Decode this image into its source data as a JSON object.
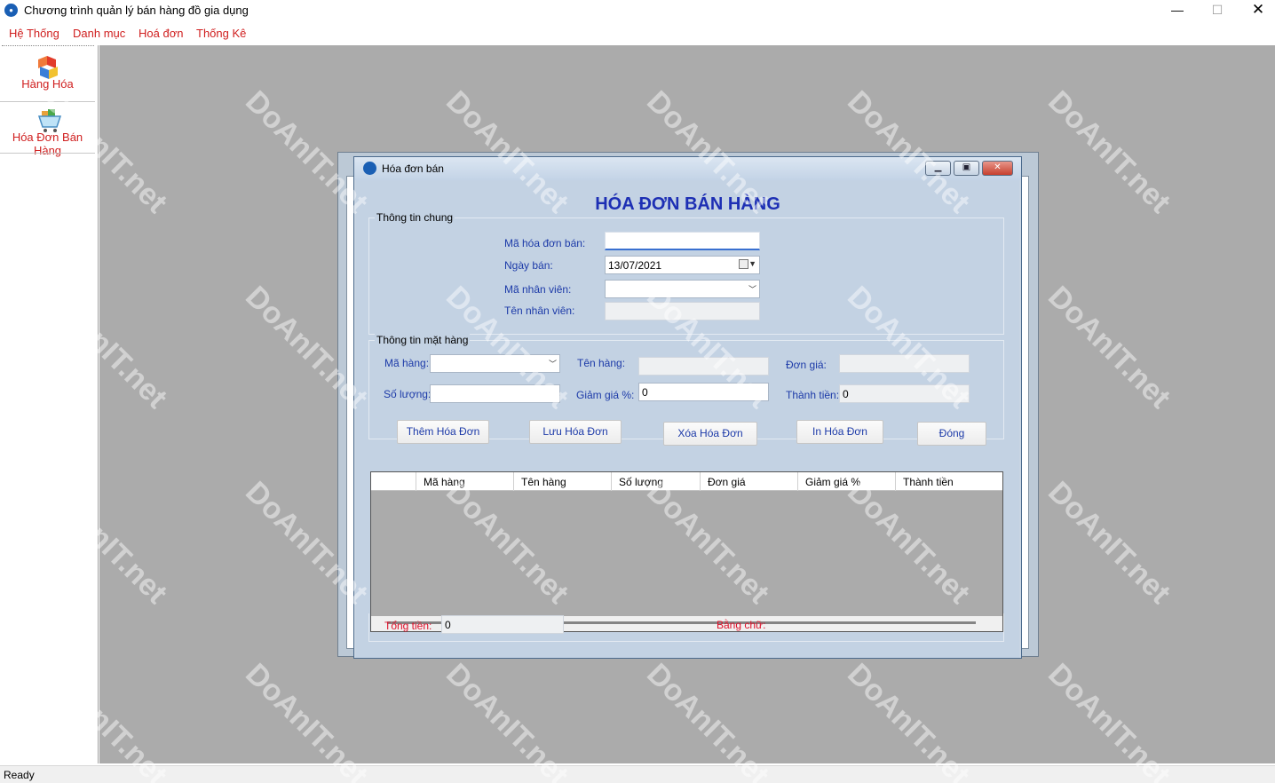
{
  "app": {
    "title": "Chương trình quản lý bán hàng đồ gia dụng",
    "window_controls": {
      "minimize": "—",
      "maximize": "☐",
      "close": "✕"
    }
  },
  "menu": [
    "Hệ Thống",
    "Danh mục",
    "Hoá đơn",
    "Thống Kê"
  ],
  "sidebar": [
    {
      "label": "Hàng Hóa",
      "icon": "boxes-icon"
    },
    {
      "label": "Hóa Đơn Bán Hàng",
      "icon": "shopping-cart-icon"
    }
  ],
  "status": "Ready",
  "invoice_window": {
    "title": "Hóa đơn bán",
    "heading": "HÓA ĐƠN BÁN HÀNG",
    "general_group": "Thông tin chung",
    "labels": {
      "invoice_id": "Mã hóa đơn bán:",
      "sale_date": "Ngày bán:",
      "employee_id": "Mã nhân viên:",
      "employee_name": "Tên nhân viên:"
    },
    "values": {
      "invoice_id": "",
      "sale_date": "13/07/2021",
      "employee_id": "",
      "employee_name": ""
    },
    "item_group": "Thông tin mặt hàng",
    "item_labels": {
      "item_code": "Mã hàng:",
      "item_name": "Tên hàng:",
      "unit_price": "Đơn giá:",
      "quantity": "Số lượng:",
      "discount": "Giảm giá %:",
      "subtotal": "Thành tiền:"
    },
    "item_values": {
      "item_code": "",
      "item_name": "",
      "unit_price": "",
      "quantity": "",
      "discount": "0",
      "subtotal": "0"
    },
    "buttons": {
      "add": "Thêm Hóa Đơn",
      "save": "Lưu Hóa Đơn",
      "delete": "Xóa Hóa Đơn",
      "print": "In Hóa Đơn",
      "close": "Đóng"
    },
    "grid_columns": [
      "Mã hàng",
      "Tên hàng",
      "Số lượng",
      "Đơn giá",
      "Giảm giá %",
      "Thành tiền"
    ],
    "total_label": "Tổng tiền:",
    "total_value": "0",
    "in_words_label": "Bằng chữ:",
    "in_words_value": ""
  },
  "watermark_text": "DoAnIT.net",
  "colors": {
    "menu_red": "#d02020",
    "label_blue": "#1c3aa8",
    "heading_blue": "#1d2fb4",
    "total_red": "#e0102a",
    "mdi_gray": "#ababab",
    "form_bg": "#c3d2e3"
  }
}
